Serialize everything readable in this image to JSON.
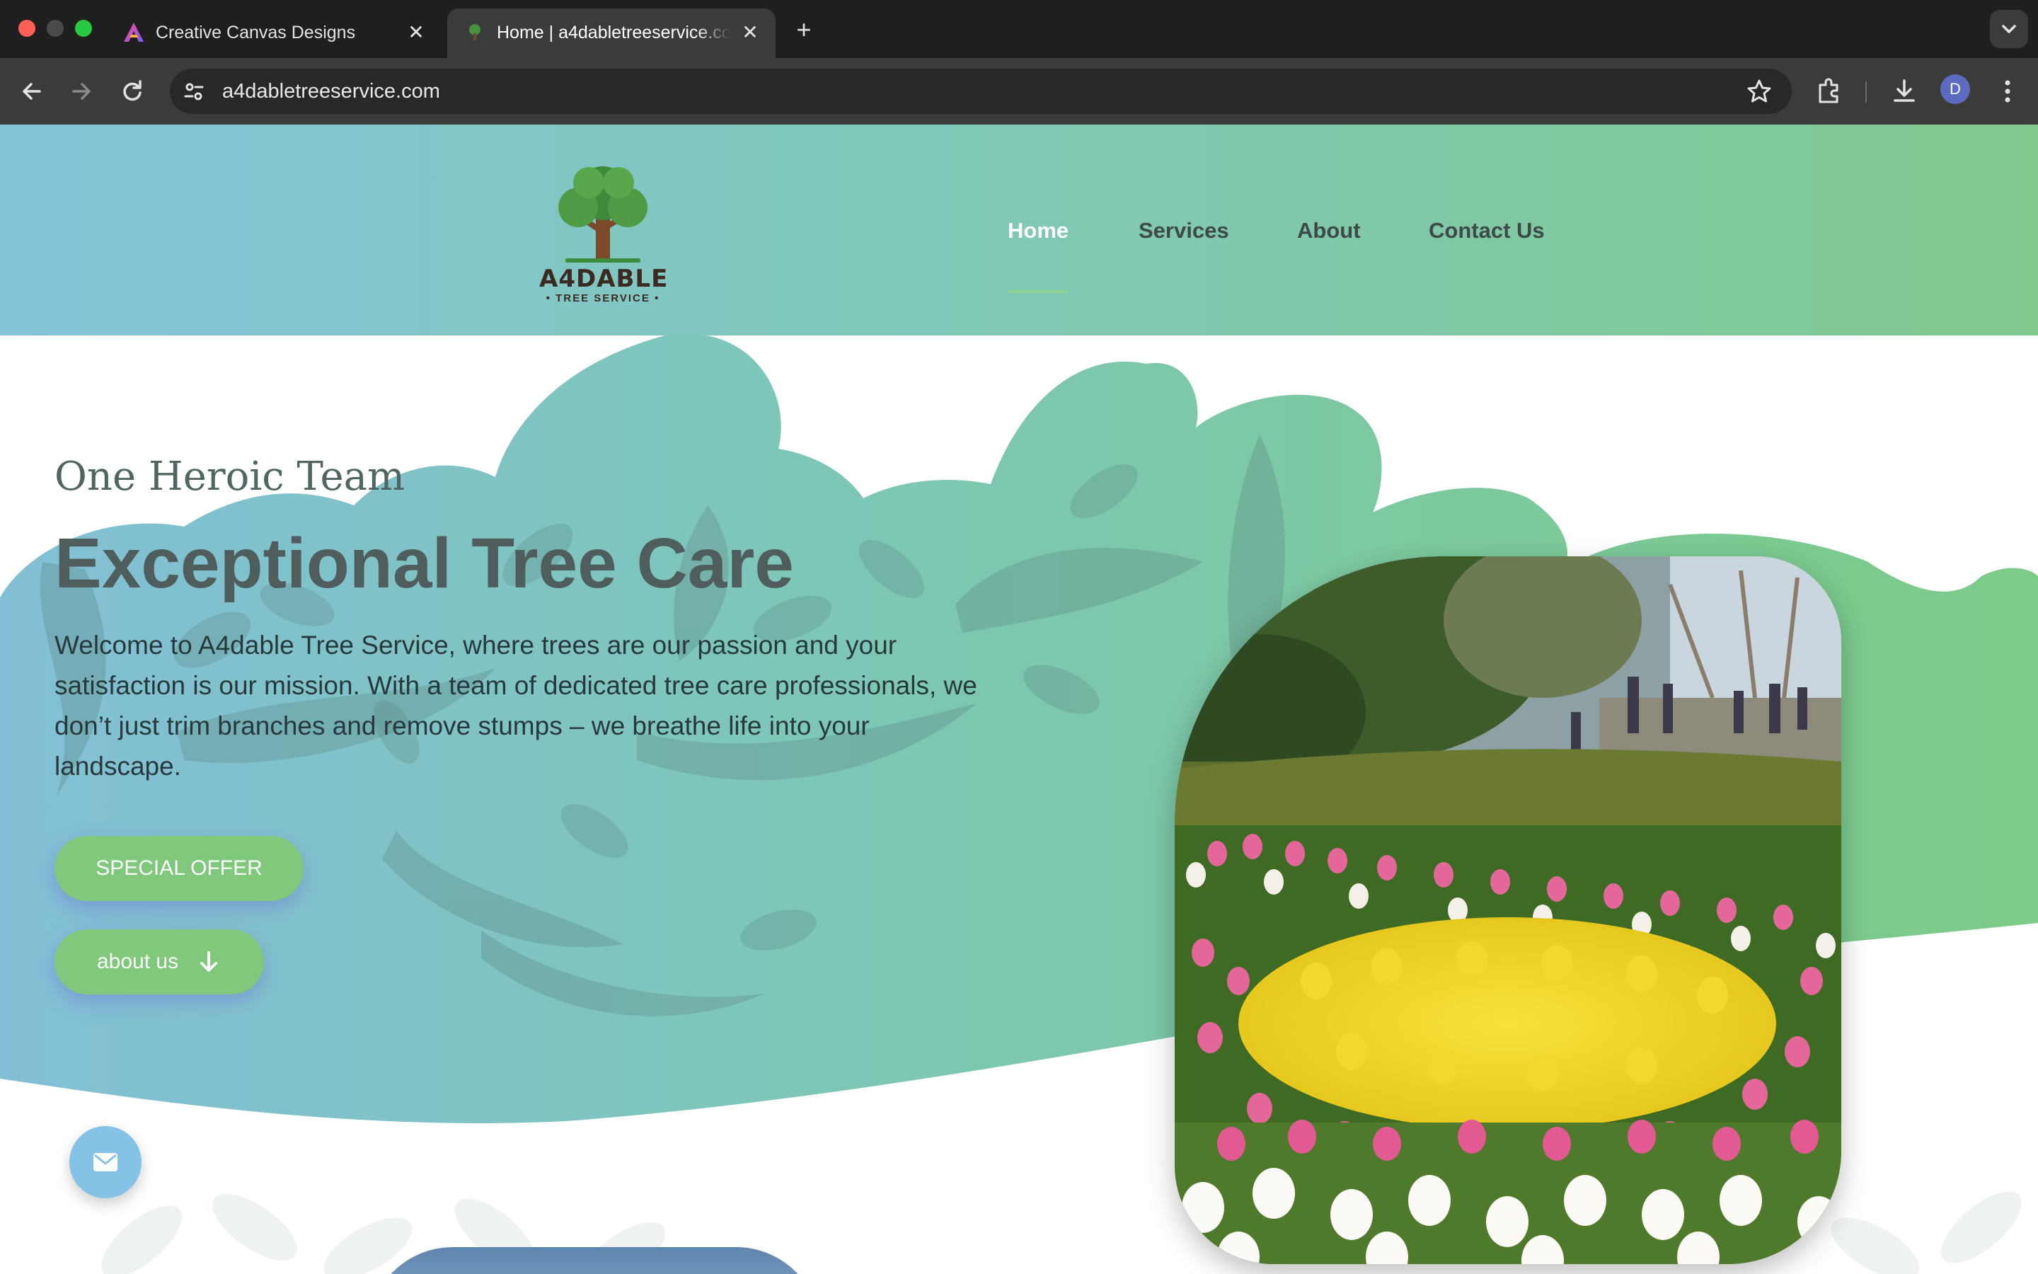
{
  "browser": {
    "tabs": [
      {
        "title": "Creative Canvas Designs",
        "active": false
      },
      {
        "title": "Home | a4dabletreeservice.com",
        "active": true
      }
    ],
    "url": "a4dabletreeservice.com",
    "profile_initial": "D"
  },
  "site": {
    "logo": {
      "name": "A4DABLE",
      "tagline": "• TREE SERVICE •"
    },
    "nav": [
      "Home",
      "Services",
      "About",
      "Contact Us"
    ],
    "active_nav": "Home"
  },
  "hero": {
    "eyebrow": "One Heroic Team",
    "headline": "Exceptional Tree Care",
    "intro": "Welcome to A4dable Tree Service, where trees are our passion and your satisfaction is our mission. With a team of dedicated tree care professionals, we don’t just trim branches and remove stumps – we breathe life into your landscape.",
    "buttons": {
      "special_offer": "SPECIAL OFFER",
      "about_us": "about us"
    }
  },
  "colors": {
    "header_start": "#84c3d8",
    "header_end": "#80c98f",
    "button": "#7fc87c",
    "fab": "#84c3e6"
  },
  "icons": [
    "back-icon",
    "forward-icon",
    "reload-icon",
    "site-info-icon",
    "star-icon",
    "extensions-icon",
    "download-icon",
    "menu-icon",
    "arrow-down-icon",
    "mail-icon"
  ]
}
